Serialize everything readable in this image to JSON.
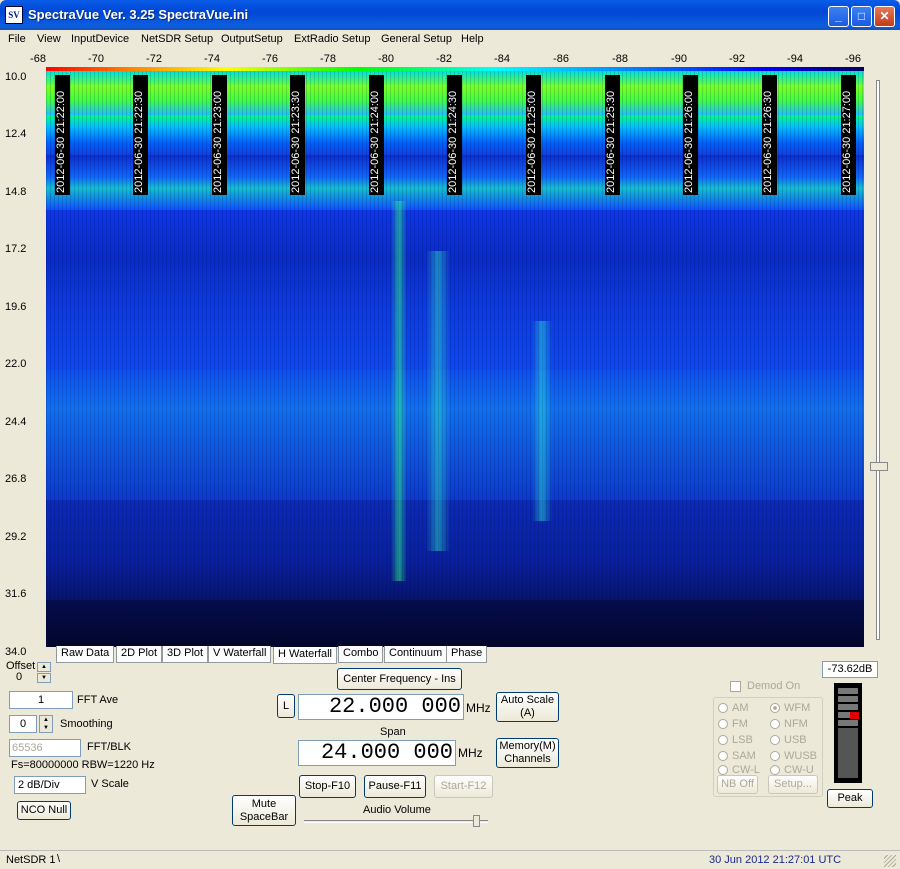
{
  "window": {
    "title": "SpectraVue Ver. 3.25  SpectraVue.ini",
    "icon_text": "SV",
    "controls": [
      "_",
      "□",
      "✕"
    ]
  },
  "menu": [
    "File",
    "View",
    "InputDevice",
    "NetSDR Setup",
    "OutputSetup",
    "ExtRadio Setup",
    "General Setup",
    "Help"
  ],
  "scale_top": [
    "-68",
    "-70",
    "-72",
    "-74",
    "-76",
    "-78",
    "-80",
    "-82",
    "-84",
    "-86",
    "-88",
    "-90",
    "-92",
    "-94",
    "-96"
  ],
  "freq_axis": [
    "10.0",
    "12.4",
    "14.8",
    "17.2",
    "19.6",
    "22.0",
    "24.4",
    "26.8",
    "29.2",
    "31.6",
    "34.0"
  ],
  "timestamps": [
    "2012-06-30 21:22:00",
    "2012-06-30 21:22:30",
    "2012-06-30 21:23:00",
    "2012-06-30 21:23:30",
    "2012-06-30 21:24:00",
    "2012-06-30 21:24:30",
    "2012-06-30 21:25:00",
    "2012-06-30 21:25:30",
    "2012-06-30 21:26:00",
    "2012-06-30 21:26:30",
    "2012-06-30 21:27:00"
  ],
  "tabs": [
    "Raw Data",
    "2D Plot",
    "3D Plot",
    "V Waterfall",
    "H Waterfall",
    "Combo",
    "Continuum",
    "Phase"
  ],
  "controls": {
    "offset_label": "Offset",
    "offset_value": "0",
    "fft_ave_value": "1",
    "fft_ave_label": "FFT Ave",
    "smoothing_value": "0",
    "smoothing_label": "Smoothing",
    "fft_blk_value": "65536",
    "fft_blk_label": "FFT/BLK",
    "fs_info": "Fs=80000000 RBW=1220 Hz",
    "vscale_value": "2 dB/Div",
    "vscale_label": "V Scale",
    "nco_null": "NCO Null",
    "mute": "Mute SpaceBar",
    "center_freq_btn": "Center Frequency - Ins",
    "l_btn": "L",
    "center_freq_value": "22.000 000",
    "mhz1": "MHz",
    "span_label": "Span",
    "span_value": "24.000 000",
    "mhz2": "MHz",
    "auto_scale": "Auto Scale (A)",
    "memory": "Memory(M) Channels",
    "stop": "Stop-F10",
    "pause": "Pause-F11",
    "start": "Start-F12",
    "audio_volume": "Audio Volume"
  },
  "demod": {
    "label": "Demod On",
    "modes": [
      {
        "name": "AM",
        "on": false
      },
      {
        "name": "WFM",
        "on": true
      },
      {
        "name": "FM",
        "on": false
      },
      {
        "name": "NFM",
        "on": false
      },
      {
        "name": "LSB",
        "on": false
      },
      {
        "name": "USB",
        "on": false
      },
      {
        "name": "SAM",
        "on": false
      },
      {
        "name": "WUSB",
        "on": false
      },
      {
        "name": "CW-L",
        "on": false
      },
      {
        "name": "CW-U",
        "on": false
      }
    ],
    "nb_off": "NB Off",
    "setup": "Setup...",
    "level": "-73.62dB",
    "peak": "Peak"
  },
  "status": {
    "left": "NetSDR 1",
    "right": "30 Jun 2012  21:27:01 UTC"
  }
}
